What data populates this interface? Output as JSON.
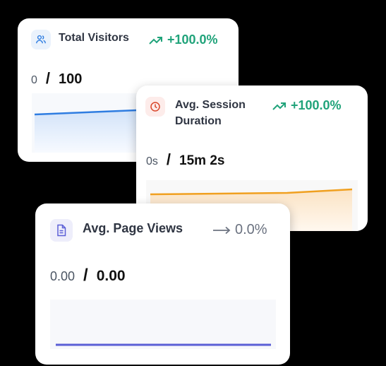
{
  "cards": {
    "visitors": {
      "title": "Total Visitors",
      "change": "+100.0%",
      "change_color": "#20a37a",
      "icon": "users-icon",
      "previous": "0",
      "current": "100",
      "line_color": "#2f7de1"
    },
    "session": {
      "title_line1": "Avg. Session",
      "title_line2": "Duration",
      "change": "+100.0%",
      "change_color": "#20a37a",
      "icon": "clock-icon",
      "previous": "0s",
      "current": "15m 2s",
      "line_color": "#f0a020"
    },
    "pages": {
      "title": "Avg. Page Views",
      "change": "0.0%",
      "change_color": "#6b7280",
      "icon": "document-icon",
      "previous": "0.00",
      "current": "0.00",
      "line_color": "#5b5fd6"
    }
  }
}
